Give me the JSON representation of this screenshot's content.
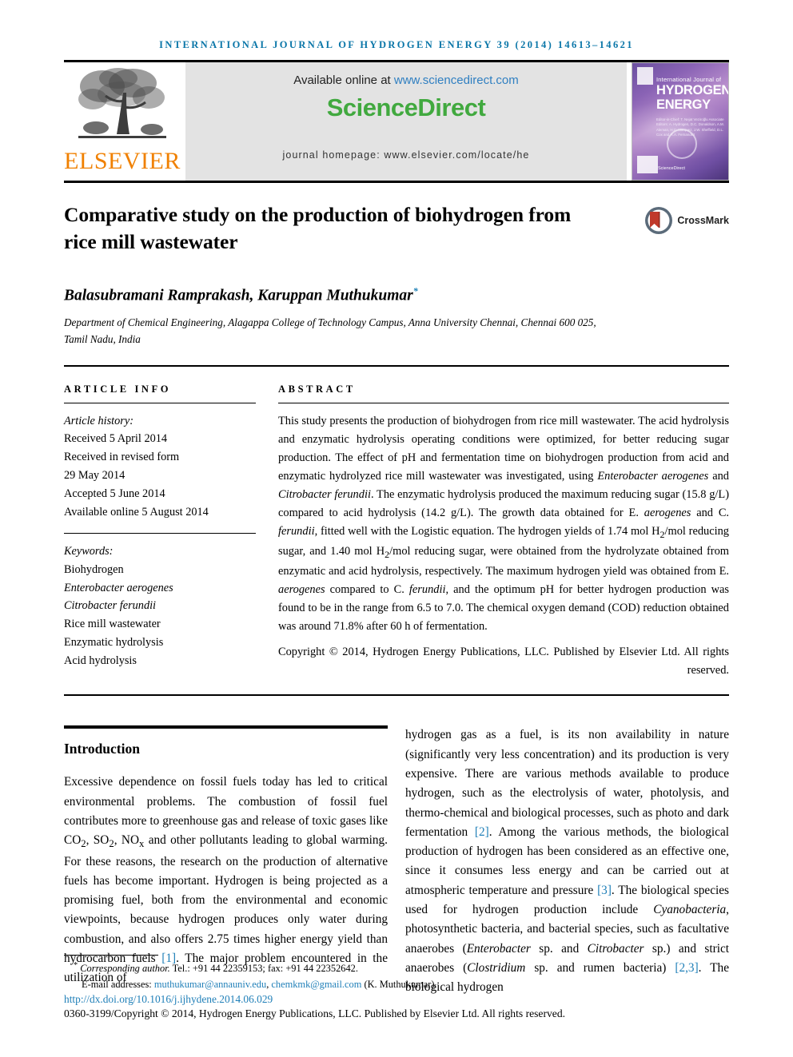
{
  "running_head": "International Journal of Hydrogen Energy 39 (2014) 14613–14621",
  "masthead": {
    "publisher_name": "ELSEVIER",
    "available_prefix": "Available online at ",
    "available_url": "www.sciencedirect.com",
    "sciencedirect_logo": "ScienceDirect",
    "journal_homepage": "journal homepage: www.elsevier.com/locate/he",
    "cover": {
      "line1": "International Journal of",
      "line2": "HYDROGEN",
      "line3": "ENERGY",
      "editors": "Editor-in-Chief: T. Nejat Veziroğlu\nAssociate Editors: A. Hydrogen, D.C. Donaldson, A.M. Aleman, H.C. Marquez, J.W. Sheffield, D.L. Cox and R.A. Fernandez",
      "footer_logo": "ScienceDirect"
    }
  },
  "article": {
    "title": "Comparative study on the production of biohydrogen from rice mill wastewater",
    "crossmark_label": "CrossMark",
    "authors": "Balasubramani Ramprakash, Karuppan Muthukumar",
    "author_marker": "*",
    "affiliation": "Department of Chemical Engineering, Alagappa College of Technology Campus, Anna University Chennai, Chennai 600 025, Tamil Nadu, India"
  },
  "article_info": {
    "heading": "Article info",
    "history_heading": "Article history:",
    "history": [
      "Received 5 April 2014",
      "Received in revised form",
      "29 May 2014",
      "Accepted 5 June 2014",
      "Available online 5 August 2014"
    ],
    "keywords_heading": "Keywords:",
    "keywords": [
      "Biohydrogen",
      "Enterobacter aerogenes",
      "Citrobacter ferundii",
      "Rice mill wastewater",
      "Enzymatic hydrolysis",
      "Acid hydrolysis"
    ]
  },
  "abstract": {
    "heading": "Abstract",
    "copyright": "Copyright © 2014, Hydrogen Energy Publications, LLC. Published by Elsevier Ltd. All rights reserved."
  },
  "introduction": {
    "heading": "Introduction"
  },
  "footnote": {
    "corresponding_marker": "*",
    "corresponding_label": "Corresponding author.",
    "tel_fax": " Tel.: +91 44 22359153; fax: +91 44 22352642.",
    "email_label": "E-mail addresses:",
    "email1": "muthukumar@annauniv.edu",
    "email2": "chemkmk@gmail.com",
    "email_owner": "(K. Muthukumar).",
    "doi": "http://dx.doi.org/10.1016/j.ijhydene.2014.06.029",
    "issn_copyright": "0360-3199/Copyright © 2014, Hydrogen Energy Publications, LLC. Published by Elsevier Ltd. All rights reserved."
  },
  "colors": {
    "running_head": "#0a76a8",
    "link": "#1f7fb8",
    "sciencedirect_green": "#41a93f",
    "elsevier_orange": "#f08000",
    "banner_bg": "#e3e3e3"
  }
}
